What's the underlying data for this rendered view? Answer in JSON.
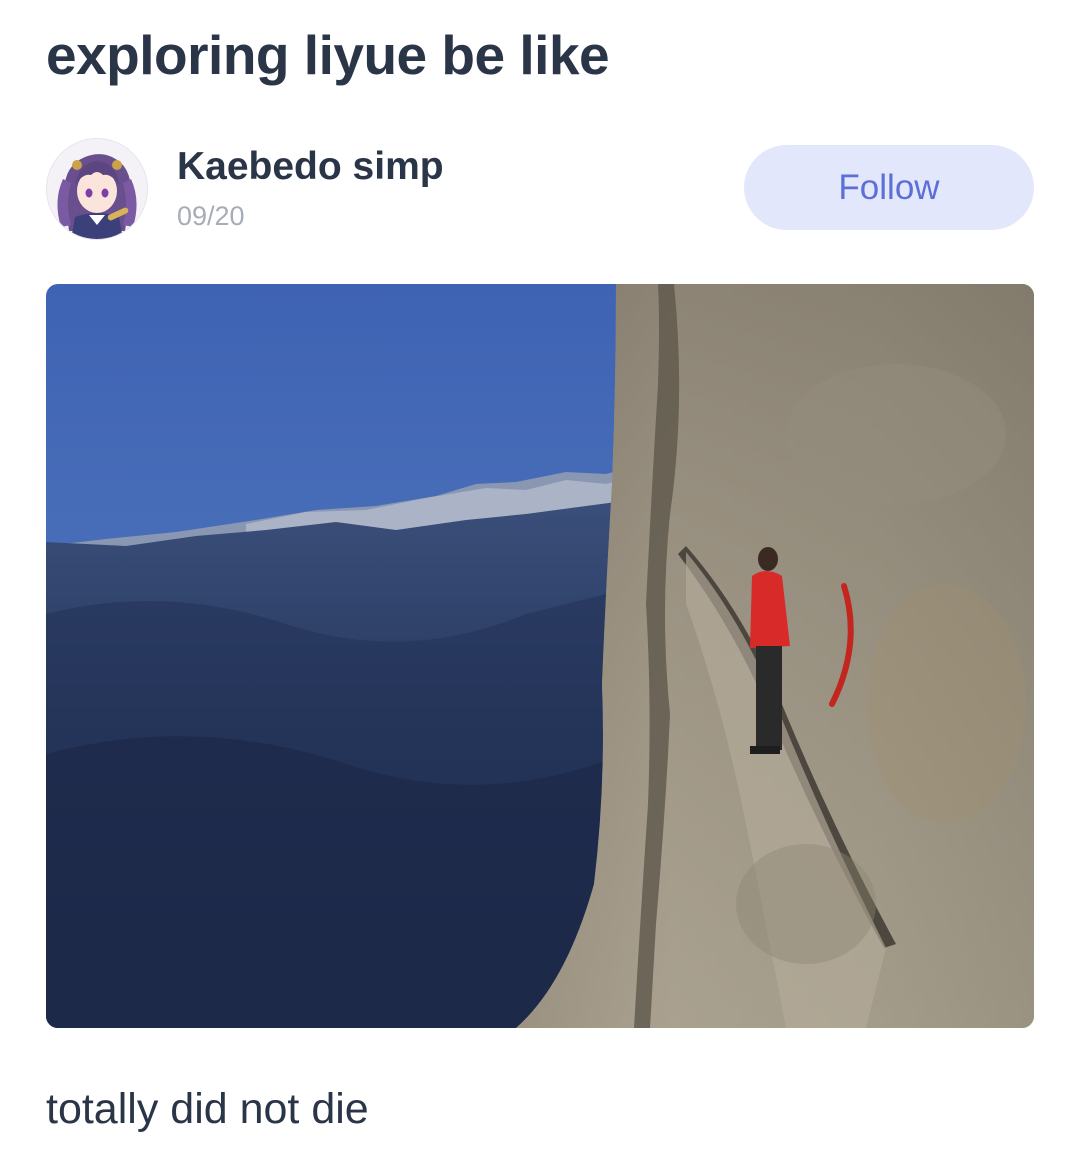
{
  "post": {
    "title": "exploring liyue be like",
    "caption": "totally did not die"
  },
  "author": {
    "name": "Kaebedo simp",
    "date": "09/20",
    "avatar_icon": "anime-character-avatar"
  },
  "follow_button": {
    "label": "Follow"
  },
  "image": {
    "subject": "cliff-ledge-photo"
  },
  "colors": {
    "text_primary": "#2b3548",
    "text_secondary": "#a6adb8",
    "follow_bg": "#e3e7fb",
    "follow_text": "#5b6fd6"
  }
}
